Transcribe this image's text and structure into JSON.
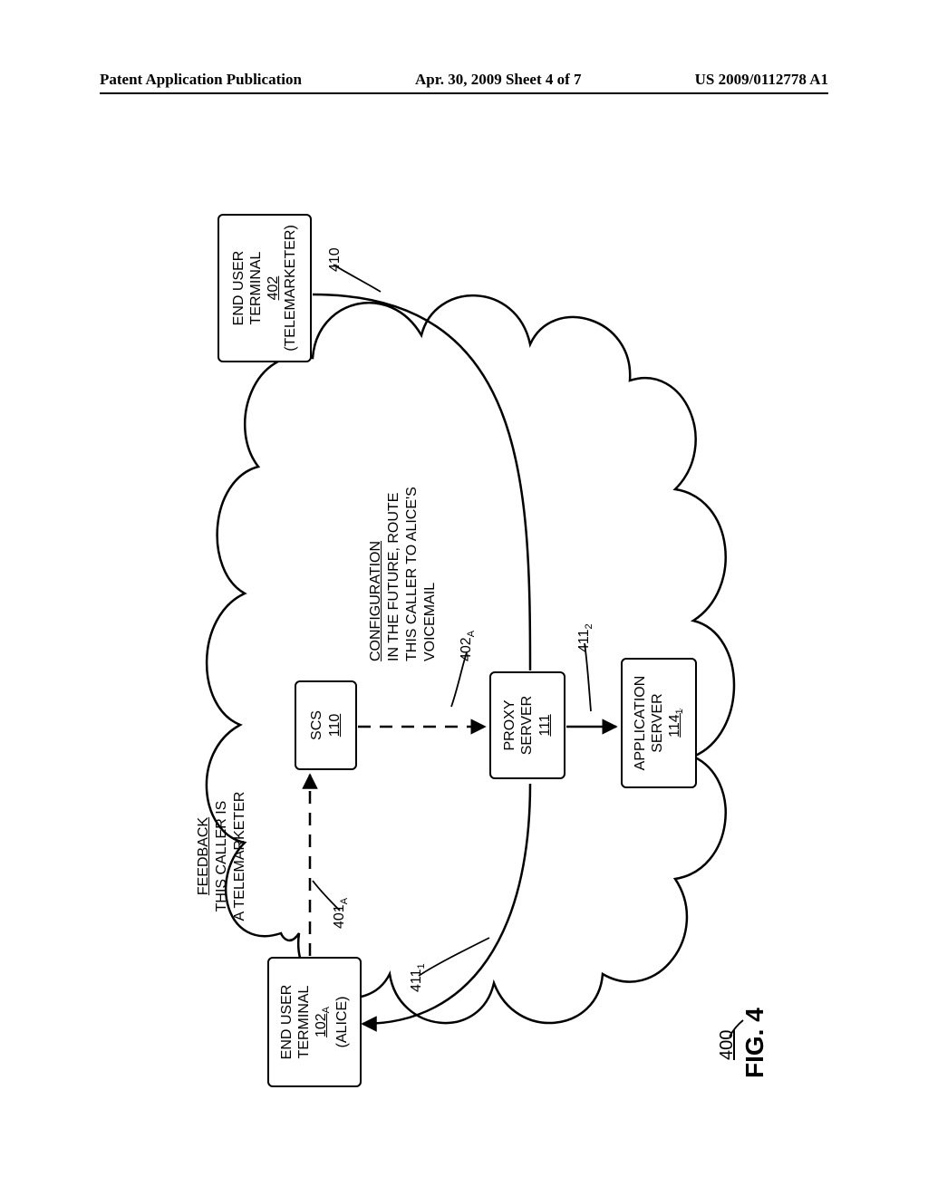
{
  "header": {
    "left": "Patent Application Publication",
    "center": "Apr. 30, 2009  Sheet 4 of 7",
    "right": "US 2009/0112778 A1"
  },
  "boxes": {
    "alice": {
      "l1": "END USER",
      "l2": "TERMINAL",
      "ref": "102",
      "ref_sub": "A",
      "l3": "(ALICE)"
    },
    "scs": {
      "l1": "SCS",
      "ref": "110"
    },
    "proxy": {
      "l1": "PROXY",
      "l2": "SERVER",
      "ref": "111"
    },
    "app": {
      "l1": "APPLICATION",
      "l2": "SERVER",
      "ref": "114",
      "ref_sub": "1"
    },
    "telemarketer": {
      "l1": "END USER",
      "l2": "TERMINAL",
      "ref": "402",
      "l3": "(TELEMARKETER)"
    }
  },
  "labels": {
    "feedback_title": "FEEDBACK",
    "feedback_body1": "THIS CALLER IS",
    "feedback_body2": "A TELEMARKETER",
    "config_title": "CONFIGURATION",
    "config_body1": "IN THE FUTURE, ROUTE",
    "config_body2": "THIS CALLER TO ALICE'S",
    "config_body3": "VOICEMAIL",
    "ref_401A": "401",
    "ref_401A_sub": "A",
    "ref_402A": "402",
    "ref_402A_sub": "A",
    "ref_410": "410",
    "ref_4111": "411",
    "ref_4111_sub": "1",
    "ref_4112": "411",
    "ref_4112_sub": "2",
    "fig_num": "400",
    "fig_caption": "FIG. 4"
  }
}
